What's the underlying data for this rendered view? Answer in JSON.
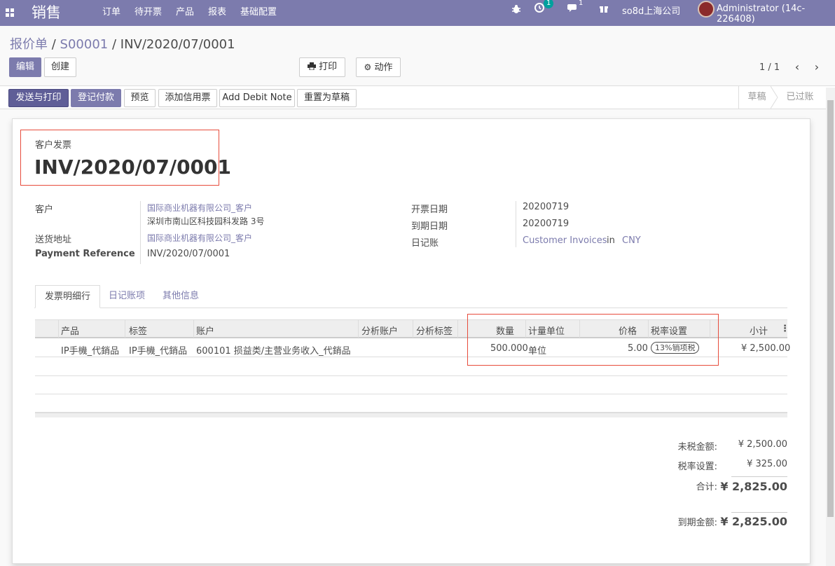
{
  "navbar": {
    "brand": "销售",
    "menu": [
      "订单",
      "待开票",
      "产品",
      "报表",
      "基础配置"
    ],
    "activity_count": "1",
    "message_count": "1",
    "company": "so8d上海公司",
    "user": "Administrator (14c-226408)",
    "bg_color": "#7c7bad"
  },
  "breadcrumb": {
    "items": [
      "报价单",
      "S00001"
    ],
    "current": "INV/2020/07/0001",
    "separator": "/"
  },
  "toolbar": {
    "edit": "编辑",
    "create": "创建",
    "print": "打印",
    "action": "动作"
  },
  "pager": {
    "value": "1 / 1"
  },
  "statusbar": {
    "buttons": [
      "发送与打印",
      "登记付款",
      "预览",
      "添加信用票",
      "Add Debit Note",
      "重置为草稿"
    ],
    "stages": [
      "草稿",
      "已过账"
    ]
  },
  "invoice": {
    "type_label": "客户发票",
    "number": "INV/2020/07/0001",
    "left": {
      "customer_label": "客户",
      "customer_name": "国际商业机器有限公司_客户",
      "customer_address": "深圳市南山区科技园科发路 3号",
      "delivery_label": "送货地址",
      "delivery_value": "国际商业机器有限公司_客户",
      "payref_label": "Payment Reference",
      "payref_value": "INV/2020/07/0001"
    },
    "right": {
      "invoice_date_label": "开票日期",
      "invoice_date": "20200719",
      "due_date_label": "到期日期",
      "due_date": "20200719",
      "journal_label": "日记账",
      "journal_value": "Customer Invoices",
      "journal_in": "in",
      "currency": "CNY"
    }
  },
  "tabs": [
    "发票明细行",
    "日记账项",
    "其他信息"
  ],
  "table": {
    "headers": {
      "product": "产品",
      "label": "标签",
      "account": "账户",
      "analytic_account": "分析账户",
      "analytic_tags": "分析标签",
      "quantity": "数量",
      "uom": "计量单位",
      "price": "价格",
      "taxes": "税率设置",
      "subtotal": "小计"
    },
    "rows": [
      {
        "product": "IP手機_代銷品",
        "label": "IP手機_代銷品",
        "account": "600101 损益类/主营业务收入_代銷品",
        "analytic_account": "",
        "analytic_tags": "",
        "quantity": "500.000",
        "uom": "单位",
        "price": "5.00",
        "taxes": "13%销项税",
        "subtotal": "¥ 2,500.00"
      }
    ]
  },
  "totals": {
    "untaxed_label": "未税金额:",
    "untaxed": "¥ 2,500.00",
    "tax_label": "税率设置:",
    "tax": "¥ 325.00",
    "total_label": "合计:",
    "total": "¥ 2,825.00",
    "due_label": "到期金额:",
    "due": "¥ 2,825.00"
  }
}
